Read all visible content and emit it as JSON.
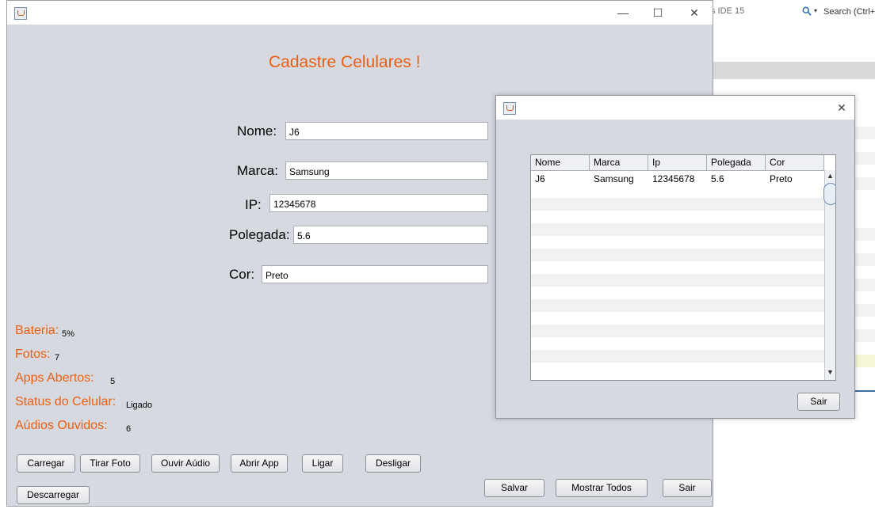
{
  "background_ide": {
    "title_fragment": "s IDE 15",
    "search_label": "Search (Ctrl+"
  },
  "main_window": {
    "controls": {
      "minimize": "—",
      "maximize": "☐",
      "close": "✕"
    },
    "heading": "Cadastre Celulares !",
    "form": {
      "nome_label": "Nome:",
      "nome_value": "J6",
      "marca_label": "Marca:",
      "marca_value": "Samsung",
      "ip_label": "IP:",
      "ip_value": "12345678",
      "polegada_label": "Polegada:",
      "polegada_value": "5.6",
      "cor_label": "Cor:",
      "cor_value": "Preto"
    },
    "status": {
      "bateria_label": "Bateria:",
      "bateria_value": "5%",
      "fotos_label": "Fotos:",
      "fotos_value": "7",
      "apps_label": "Apps Abertos:",
      "apps_value": "5",
      "status_label": "Status do Celular:",
      "status_value": "Ligado",
      "audios_label": "Aúdios Ouvidos:",
      "audios_value": "6"
    },
    "buttons": {
      "carregar": "Carregar",
      "tirar_foto": "Tirar Foto",
      "ouvir_audio": "Ouvir Aúdio",
      "abrir_app": "Abrir App",
      "ligar": "Ligar",
      "desligar": "Desligar",
      "descarregar": "Descarregar",
      "salvar": "Salvar",
      "mostrar_todos": "Mostrar Todos",
      "sair": "Sair"
    }
  },
  "dialog": {
    "close": "✕",
    "table": {
      "columns": [
        "Nome",
        "Marca",
        "Ip",
        "Polegada",
        "Cor"
      ],
      "rows": [
        [
          "J6",
          "Samsung",
          "12345678",
          "5.6",
          "Preto"
        ]
      ]
    },
    "scroll_up": "▲",
    "scroll_down": "▼",
    "sair_button": "Sair"
  }
}
